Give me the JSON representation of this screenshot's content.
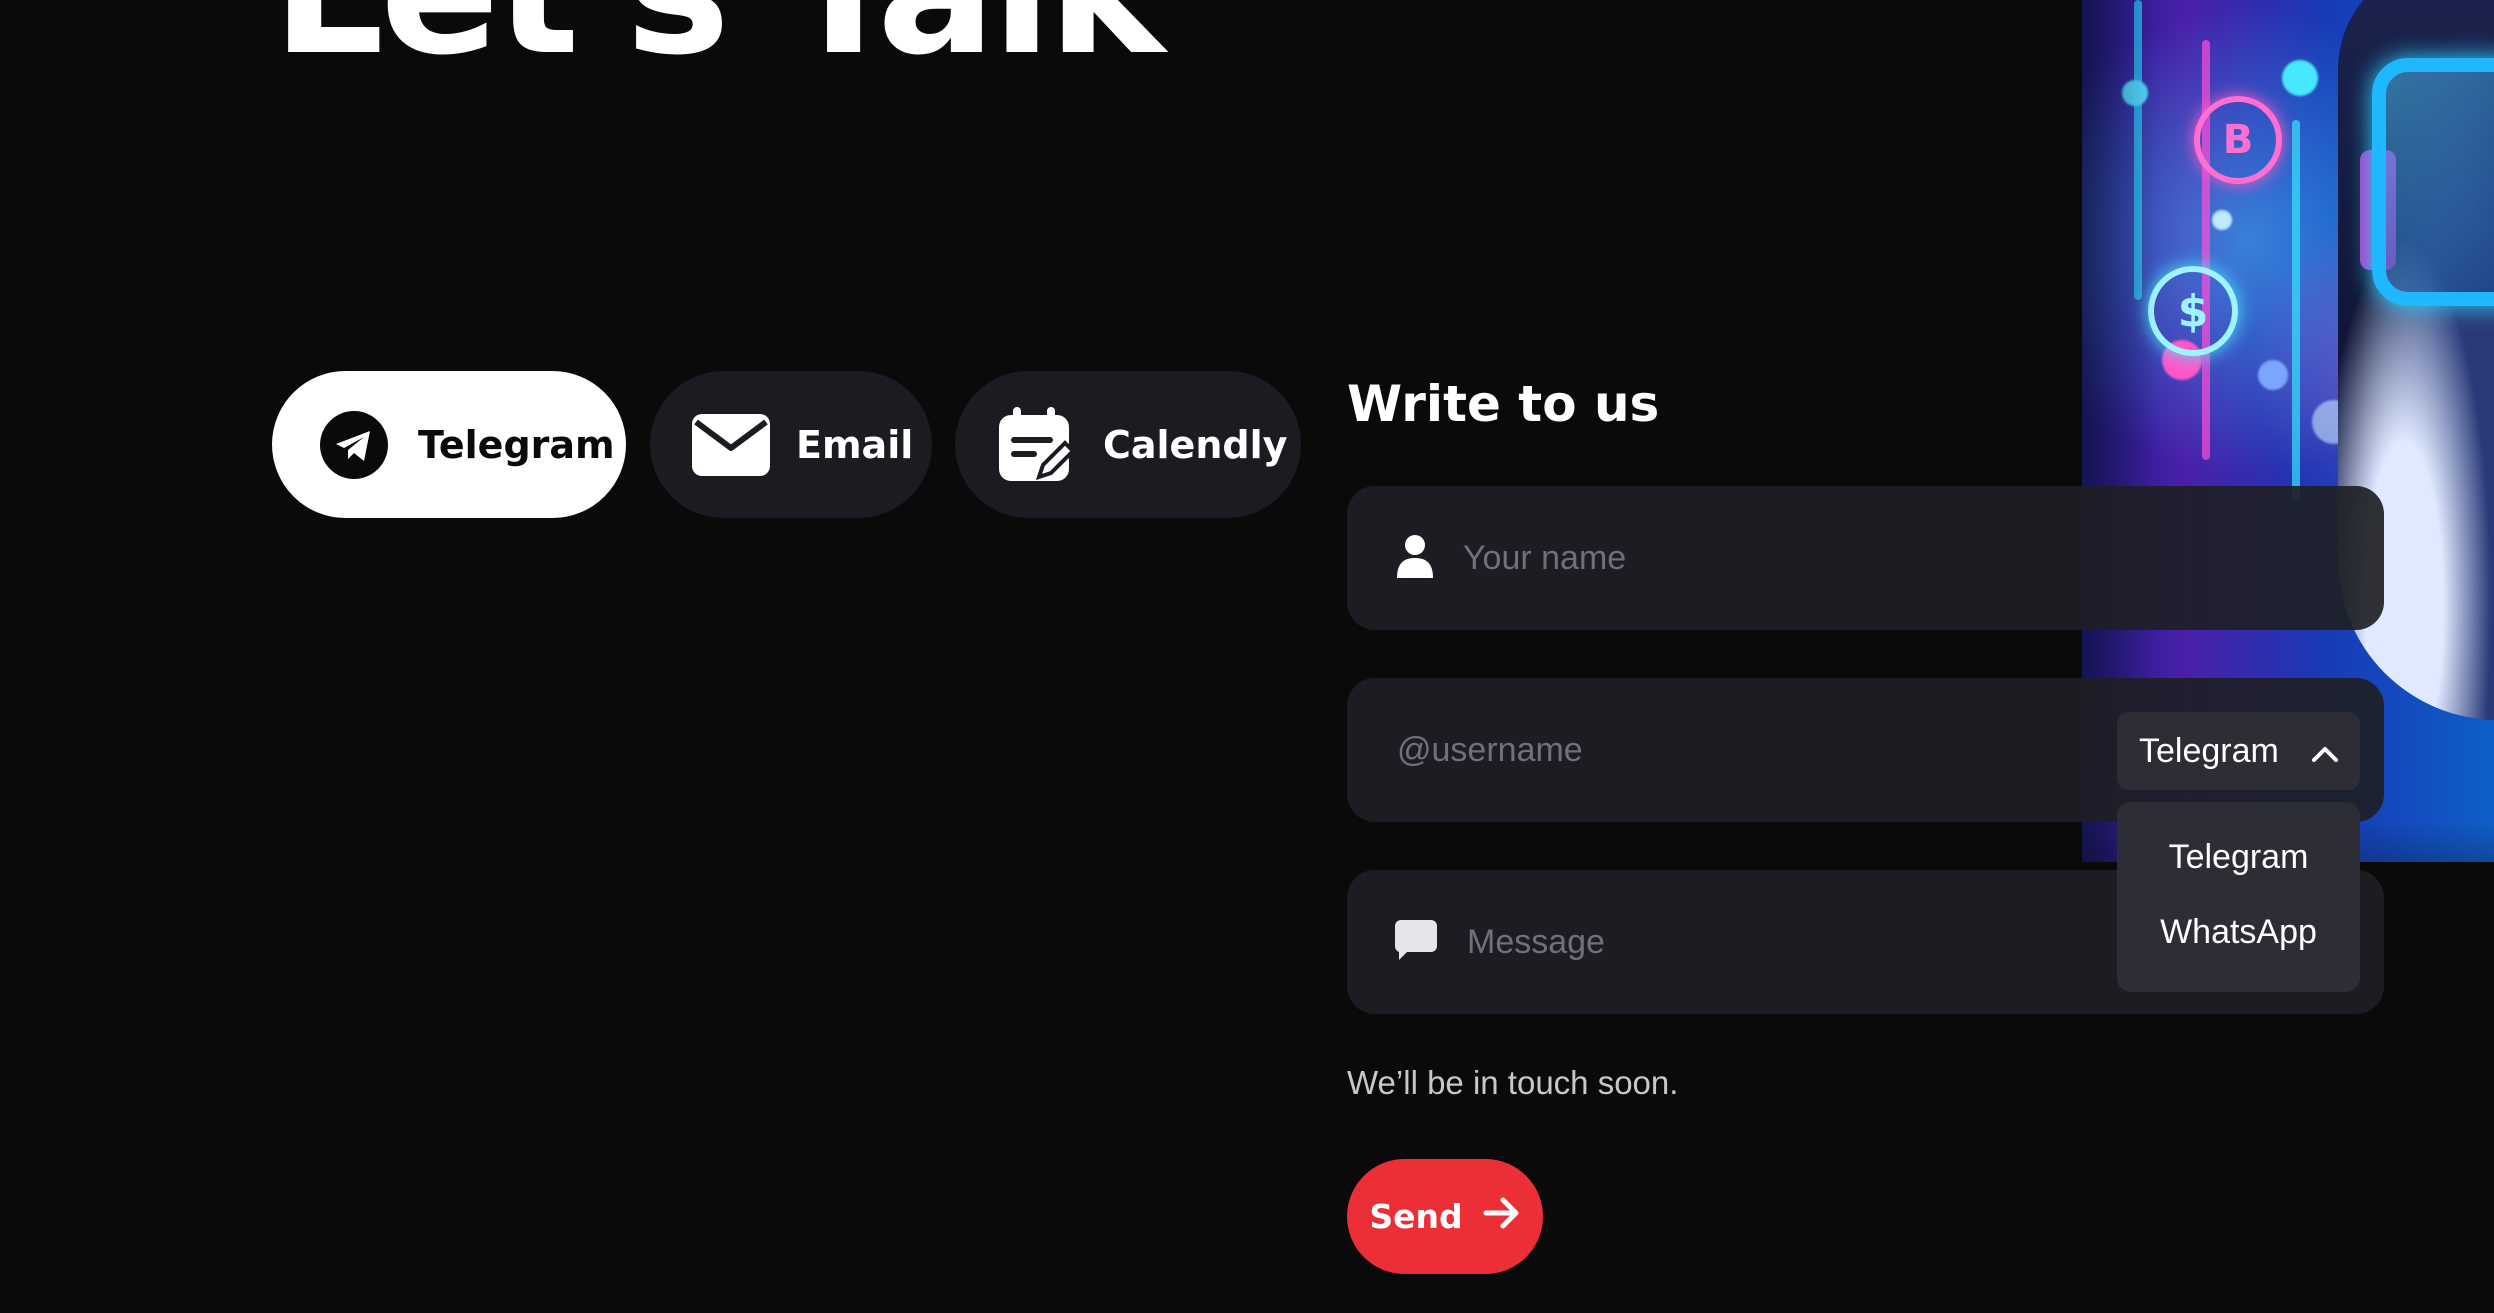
{
  "hero": {
    "title": "Let's Talk"
  },
  "contact_methods": [
    {
      "label": "Telegram",
      "icon": "telegram-icon",
      "active": true
    },
    {
      "label": "Email",
      "icon": "envelope-icon",
      "active": false
    },
    {
      "label": "Calendly",
      "icon": "calendar-edit-icon",
      "active": false
    }
  ],
  "form": {
    "title": "Write to us",
    "name_placeholder": "Your name",
    "username_placeholder": "@username",
    "message_placeholder": "Message",
    "messenger_select": {
      "selected": "Telegram",
      "options": [
        "Telegram",
        "WhatsApp"
      ]
    },
    "note": "We’ll be in touch soon.",
    "send_label": "Send"
  },
  "art": {
    "coins": [
      "B",
      "$"
    ]
  },
  "colors": {
    "background": "#0a0a0b",
    "surface": "#1b1c21",
    "send_accent": "#ec2f37",
    "active_button": "#ffffff"
  }
}
